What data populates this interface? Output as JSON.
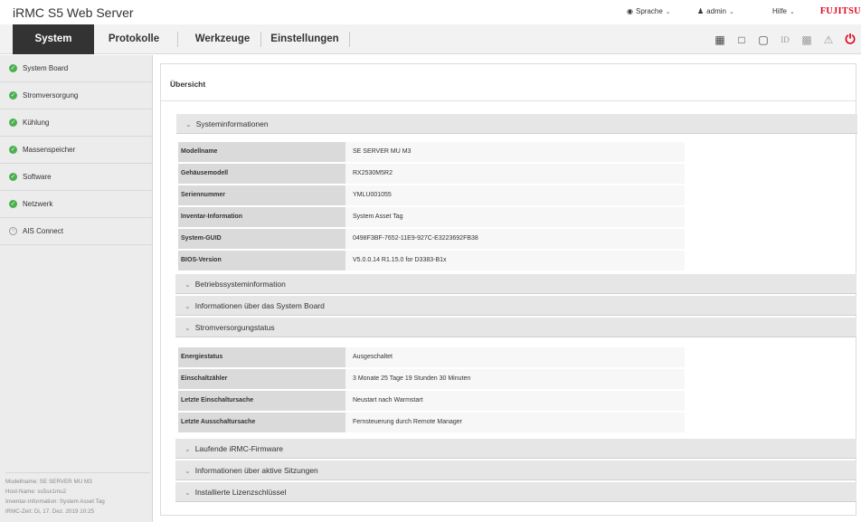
{
  "header": {
    "title": "iRMC S5 Web Server",
    "language_label": "Sprache",
    "user_label": "admin",
    "help_label": "Hilfe",
    "brand": "FUJITSU"
  },
  "nav": {
    "tabs": [
      {
        "label": "System",
        "active": true
      },
      {
        "label": "Protokolle",
        "active": false
      },
      {
        "label": "Werkzeuge",
        "active": false
      },
      {
        "label": "Einstellungen",
        "active": false
      }
    ]
  },
  "sidebar": {
    "items": [
      {
        "label": "System Board",
        "status": "ok"
      },
      {
        "label": "Stromversorgung",
        "status": "ok"
      },
      {
        "label": "Kühlung",
        "status": "ok"
      },
      {
        "label": "Massenspeicher",
        "status": "ok"
      },
      {
        "label": "Software",
        "status": "ok"
      },
      {
        "label": "Netzwerk",
        "status": "ok"
      },
      {
        "label": "AIS Connect",
        "status": "neutral"
      }
    ],
    "info": [
      "Modellname: SE SERVER MU M3",
      "Host-Name: ss5sx1mu2",
      "Inventar-Information: System Asset Tag",
      "iRMC-Zeit: Di, 17. Dez. 2019 10:25"
    ]
  },
  "main": {
    "title": "Übersicht",
    "sections": {
      "system_info": {
        "label": "Systeminformationen",
        "rows": [
          {
            "key": "Modellname",
            "value": "SE SERVER MU M3"
          },
          {
            "key": "Gehäusemodell",
            "value": "RX2530M5R2"
          },
          {
            "key": "Seriennummer",
            "value": "YMLU001055"
          },
          {
            "key": "Inventar-Information",
            "value": "System Asset Tag"
          },
          {
            "key": "System-GUID",
            "value": "0498F3BF-7652-11E9-927C-E3223692FB38"
          },
          {
            "key": "BIOS-Version",
            "value": "V5.0.0.14 R1.15.0 for D3383-B1x"
          }
        ]
      },
      "os_info": {
        "label": "Betriebssysteminformation"
      },
      "board_info": {
        "label": "Informationen über das System Board"
      },
      "power_status": {
        "label": "Stromversorgungstatus",
        "rows": [
          {
            "key": "Energiestatus",
            "value": "Ausgeschaltet"
          },
          {
            "key": "Einschaltzähler",
            "value": "3 Monate 25 Tage 19 Stunden 30 Minuten"
          },
          {
            "key": "Letzte Einschaltursache",
            "value": "Neustart nach Warmstart"
          },
          {
            "key": "Letzte Ausschaltursache",
            "value": "Fernsteuerung durch Remote Manager"
          }
        ]
      },
      "firmware": {
        "label": "Laufende iRMC-Firmware"
      },
      "sessions": {
        "label": "Informationen über aktive Sitzungen"
      },
      "licenses": {
        "label": "Installierte Lizenzschlüssel"
      }
    }
  },
  "colors": {
    "active_tab": "#333333",
    "status_ok": "#4caf50",
    "power": "#e2001a",
    "brand": "#e2001a"
  },
  "icons": [
    "globe-icon",
    "user-icon",
    "chevron-down-icon",
    "dashboard-icon",
    "message-icon",
    "window-icon",
    "console-icon",
    "id-icon",
    "video-icon",
    "warning-icon",
    "power-icon",
    "check-icon",
    "circle-icon",
    "arrow-icon"
  ]
}
